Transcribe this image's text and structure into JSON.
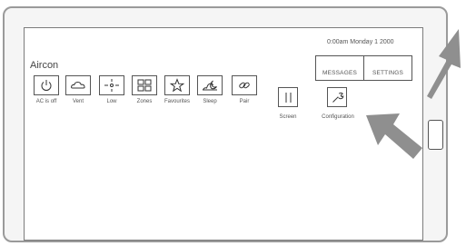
{
  "status": {
    "clock": "0:00am Monday 1  2000"
  },
  "page": {
    "title": "Aircon"
  },
  "header_buttons": {
    "messages": "MESSAGES",
    "settings": "SETTINGS"
  },
  "controls": [
    {
      "label": "AC is off",
      "icon": "power-icon"
    },
    {
      "label": "Vent",
      "icon": "cloud-icon"
    },
    {
      "label": "Low",
      "icon": "fan-speed-icon"
    },
    {
      "label": "Zones",
      "icon": "zones-grid-icon"
    },
    {
      "label": "Favourites",
      "icon": "star-icon"
    },
    {
      "label": "Sleep",
      "icon": "sleep-icon"
    },
    {
      "label": "Pair",
      "icon": "link-icon"
    }
  ],
  "secondary": {
    "screen_label": "Screen",
    "config_label": "Configuration"
  }
}
